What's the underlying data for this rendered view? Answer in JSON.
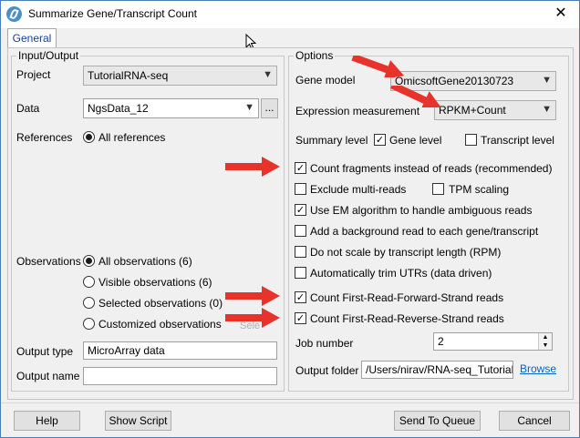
{
  "window": {
    "title": "Summarize Gene/Transcript Count",
    "close_glyph": "✕"
  },
  "tabs": [
    {
      "label": "General"
    }
  ],
  "input_output": {
    "legend": "Input/Output",
    "project_label": "Project",
    "project_value": "TutorialRNA-seq",
    "data_label": "Data",
    "data_value": "NgsData_12",
    "data_browse": "...",
    "references_label": "References",
    "references_option": "All references",
    "observations_label": "Observations",
    "observations_options": [
      {
        "label": "All observations (6)",
        "selected": true
      },
      {
        "label": "Visible observations (6)",
        "selected": false
      },
      {
        "label": "Selected observations (0)",
        "selected": false
      },
      {
        "label": "Customized observations",
        "selected": false
      }
    ],
    "observations_select_text": "Sele",
    "output_type_label": "Output type",
    "output_type_value": "MicroArray data",
    "output_name_label": "Output name",
    "output_name_value": ""
  },
  "options": {
    "legend": "Options",
    "gene_model_label": "Gene model",
    "gene_model_value": "OmicsoftGene20130723",
    "expression_label": "Expression measurement",
    "expression_value": "RPKM+Count",
    "summary_level_label": "Summary level",
    "gene_level": {
      "label": "Gene level",
      "checked": true
    },
    "transcript_level": {
      "label": "Transcript level",
      "checked": false
    },
    "checkboxes": {
      "count_fragments": {
        "label": "Count fragments instead of reads (recommended)",
        "checked": true
      },
      "exclude_multi": {
        "label": "Exclude multi-reads",
        "checked": false
      },
      "tpm_scaling": {
        "label": "TPM scaling",
        "checked": false
      },
      "use_em": {
        "label": "Use EM algorithm to handle ambiguous reads",
        "checked": true
      },
      "add_background": {
        "label": "Add a background read to each gene/transcript",
        "checked": false
      },
      "no_scale": {
        "label": "Do not scale by transcript length (RPM)",
        "checked": false
      },
      "trim_utrs": {
        "label": "Automatically trim UTRs (data driven)",
        "checked": false
      },
      "first_forward": {
        "label": "Count First-Read-Forward-Strand reads",
        "checked": true
      },
      "first_reverse": {
        "label": "Count First-Read-Reverse-Strand reads",
        "checked": true
      }
    },
    "job_number_label": "Job number",
    "job_number_value": "2",
    "output_folder_label": "Output folder",
    "output_folder_value": "/Users/nirav/RNA-seq_Tutorial/G",
    "browse_label": "Browse"
  },
  "footer": {
    "help": "Help",
    "show_script": "Show Script",
    "send_to_queue": "Send To Queue",
    "cancel": "Cancel"
  },
  "colors": {
    "annotation_arrow": "#e8332d",
    "link": "#0066cc",
    "tab_text": "#1a3f91"
  },
  "icons": [
    "app-logo-icon",
    "close-icon",
    "chevron-down-icon",
    "check-icon",
    "spin-up-icon",
    "spin-down-icon",
    "mouse-cursor-icon",
    "annotation-arrow-icon"
  ]
}
